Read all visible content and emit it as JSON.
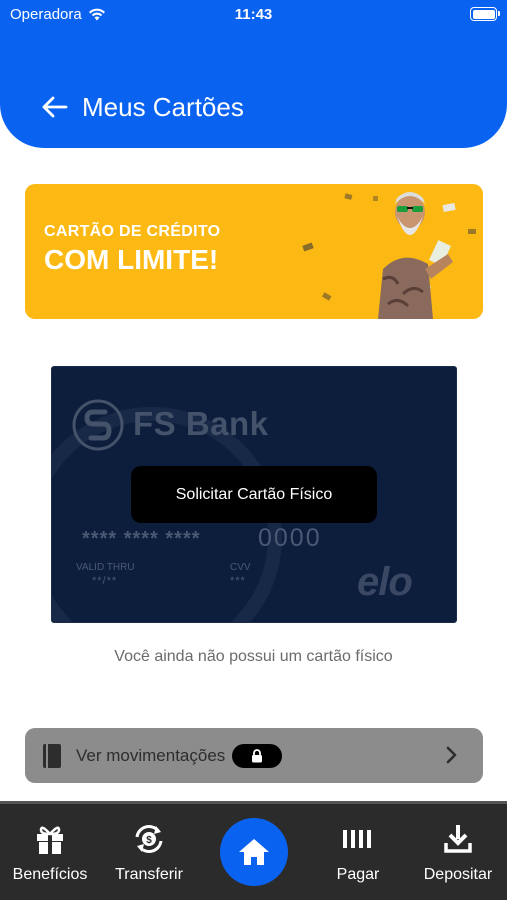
{
  "status_bar": {
    "carrier": "Operadora",
    "time": "11:43"
  },
  "header": {
    "title": "Meus Cartões",
    "back_icon": "arrow-left-icon"
  },
  "promo_banner": {
    "line1": "CARTÃO DE CRÉDITO",
    "line2": "COM LIMITE!",
    "color": "#FDB913"
  },
  "card": {
    "brand": "FS Bank",
    "number_mask": "**** **** ****",
    "number_last": "0000",
    "valid_label": "VALID THRU",
    "valid_value": "**/**",
    "cvv_label": "CVV",
    "cvv_value": "***",
    "network": "elo",
    "request_button": "Solicitar Cartão Físico"
  },
  "no_card_message": "Você ainda não possui um cartão físico",
  "movements": {
    "label": "Ver movimentações",
    "lock_icon": "lock-icon",
    "chevron_icon": "chevron-right-icon"
  },
  "bottom_nav": {
    "items": [
      {
        "label": "Benefícios",
        "icon": "gift-icon"
      },
      {
        "label": "Transferir",
        "icon": "transfer-icon"
      },
      {
        "label": "",
        "icon": "home-icon"
      },
      {
        "label": "Pagar",
        "icon": "barcode-icon"
      },
      {
        "label": "Depositar",
        "icon": "download-icon"
      }
    ]
  },
  "colors": {
    "primary": "#0A63F0",
    "card_bg": "#0D1E3D",
    "nav_bg": "#2b2b2b",
    "movements_bg": "#8c8c8c"
  }
}
